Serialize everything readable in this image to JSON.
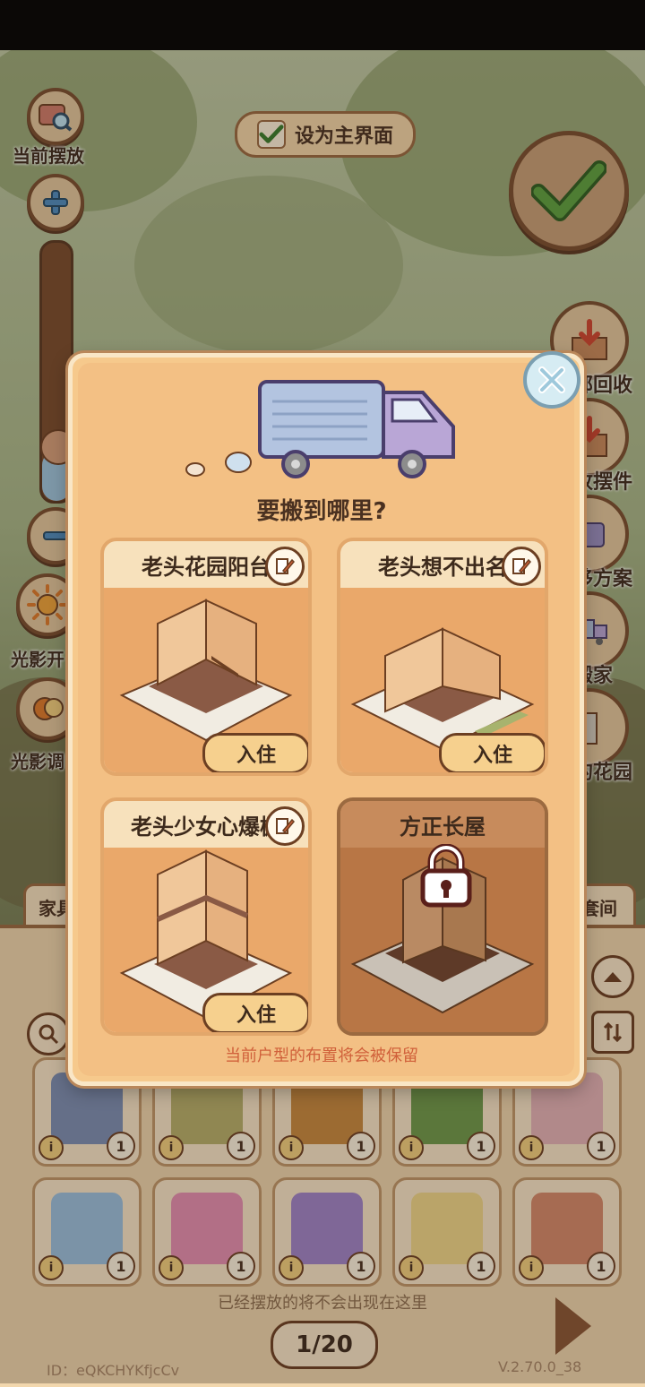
{
  "left_tools": {
    "current_layout_label": "当前摆放",
    "light_on_label": "光影开",
    "light_adjust_label": "光影调"
  },
  "top": {
    "set_main_label": "设为主界面"
  },
  "right_tools": {
    "recycle_all_label": "部回收",
    "store_label": "收摆件",
    "plan_label": "移方案",
    "move_label": "搬家",
    "garden_label": "的花园"
  },
  "tabs": {
    "furniture": "家具",
    "suite": "套间"
  },
  "dialog": {
    "title": "要搬到哪里?",
    "footnote": "当前户型的布置将会被保留",
    "cards": [
      {
        "name": "老头花园阳台",
        "action": "入住",
        "editable": true,
        "locked": false
      },
      {
        "name": "老头想不出名",
        "action": "入住",
        "editable": true,
        "locked": false
      },
      {
        "name": "老头少女心爆棚",
        "action": "入住",
        "editable": true,
        "locked": false
      },
      {
        "name": "方正长屋",
        "action": "",
        "editable": false,
        "locked": true
      }
    ]
  },
  "items": [
    {
      "icon": "scales-desk-icon",
      "count": "1"
    },
    {
      "icon": "plant-rug-icon",
      "count": "1"
    },
    {
      "icon": "fruit-basket-icon",
      "count": "1"
    },
    {
      "icon": "grass-patch-icon",
      "count": "1"
    },
    {
      "icon": "cake-stand-icon",
      "count": "1"
    },
    {
      "icon": "robot-lamp-icon",
      "count": "1"
    },
    {
      "icon": "pink-doll-icon",
      "count": "1"
    },
    {
      "icon": "purple-doll-icon",
      "count": "1"
    },
    {
      "icon": "bathtub-icon",
      "count": "1"
    },
    {
      "icon": "gift-box-icon",
      "count": "1"
    }
  ],
  "bottom": {
    "hint": "已经摆放的将不会出现在这里",
    "page": "1/20",
    "id_text": "ID：eQKCHYKfjcCv",
    "version": "V.2.70.0_38"
  },
  "colors": {
    "panel": "#f6c98c",
    "accent_brown": "#6c3f22",
    "check_green": "#3a7d2c",
    "footnote_red": "#d0603a"
  }
}
